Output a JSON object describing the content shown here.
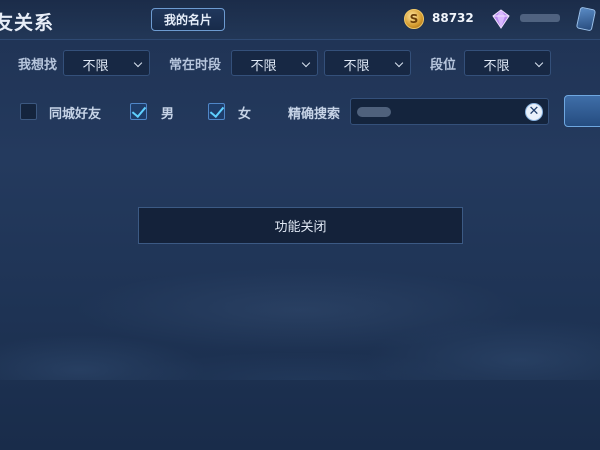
{
  "header": {
    "title": "友关系",
    "card_button_label": "我的名片",
    "coin_symbol": "S",
    "coin_amount": "88732"
  },
  "filters": {
    "want_label": "我想找",
    "want_value": "不限",
    "time_label": "常在时段",
    "time_start_value": "不限",
    "time_end_value": "不限",
    "rank_label": "段位",
    "rank_value": "不限"
  },
  "options": {
    "same_city_label": "同城好友",
    "same_city_checked": false,
    "male_label": "男",
    "male_checked": true,
    "female_label": "女",
    "female_checked": true,
    "precise_search_label": "精确搜索",
    "clear_symbol": "✕"
  },
  "main": {
    "status_text": "功能关闭"
  },
  "icons": {
    "coin": "gold-coin-icon",
    "gem": "diamond-gem-icon",
    "ticket": "ticket-card-icon",
    "chevron": "chevron-down-icon",
    "clear": "clear-x-icon"
  },
  "colors": {
    "accent": "#5fd0ff",
    "background": "#223757",
    "border": "#34507a"
  }
}
